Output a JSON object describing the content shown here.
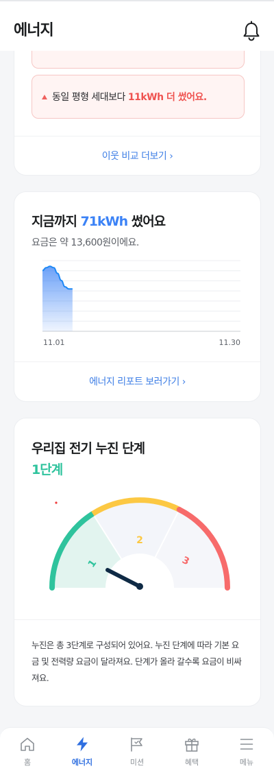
{
  "header": {
    "title": "에너지",
    "bell_icon": "bell-icon"
  },
  "neighbor_card": {
    "alert_prefix": "동일 평형 세대보다 ",
    "alert_highlight": "11kWh 더 썼어요.",
    "link_label": "이웃 비교 더보기 ›",
    "alert_color": "#ef5350"
  },
  "usage_card": {
    "title_prefix": "지금까지 ",
    "title_value": "71kWh",
    "title_suffix": " 썼어요",
    "subtitle": "요금은 약 13,600원이에요.",
    "link_label": "에너지 리포트 보러가기 ›",
    "accent_color": "#3b82f6",
    "chart_data": {
      "type": "area",
      "x_start_label": "11.01",
      "x_end_label": "11.30",
      "series": [
        {
          "values": [
            86,
            90,
            92,
            90,
            82,
            72,
            63,
            60,
            60
          ]
        }
      ],
      "ylim": [
        0,
        100
      ],
      "x_count": 30,
      "grid": true
    }
  },
  "leak_card": {
    "title": "우리집 전기 누진 단계",
    "level_label": "1단계",
    "level_value": 1,
    "segment_labels": [
      "1",
      "2",
      "3"
    ],
    "segment_colors": [
      "#2fc39d",
      "#fcc843",
      "#f76b6b"
    ],
    "description": "누진은 총 3단계로 구성되어 있어요. 누진 단계에 따라 기본 요금 및 전력량 요금이 달라져요. 단계가 올라 갈수록 요금이 비싸져요."
  },
  "tabbar": {
    "items": [
      {
        "label": "홈",
        "icon": "home-icon",
        "active": false
      },
      {
        "label": "에너지",
        "icon": "lightning-icon",
        "active": true
      },
      {
        "label": "미션",
        "icon": "flag-icon",
        "active": false
      },
      {
        "label": "혜택",
        "icon": "gift-icon",
        "active": false
      },
      {
        "label": "메뉴",
        "icon": "menu-icon",
        "active": false
      }
    ]
  }
}
